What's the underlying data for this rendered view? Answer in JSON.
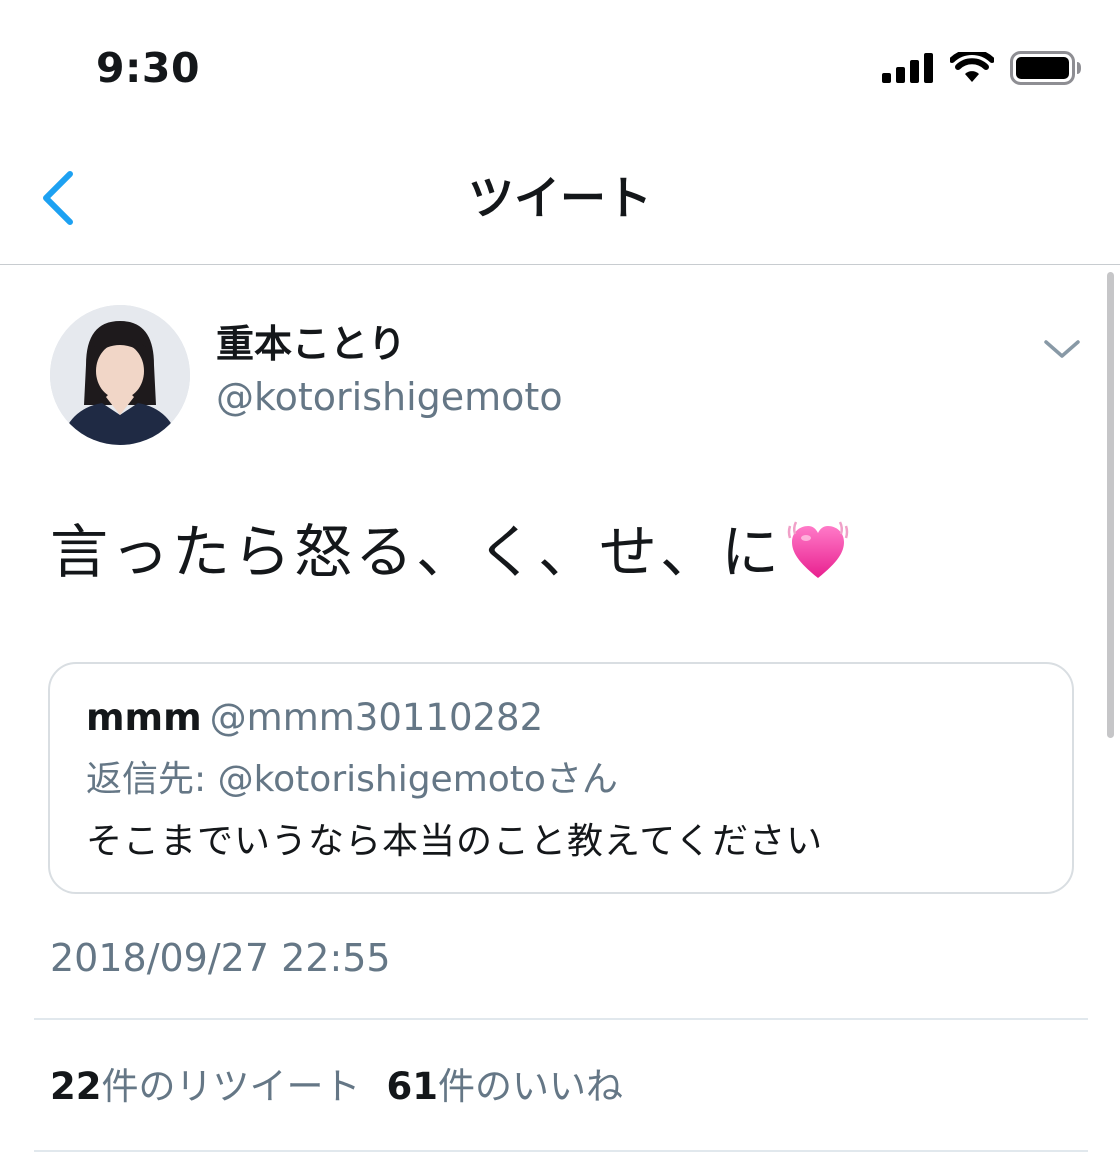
{
  "status_bar": {
    "time": "9:30",
    "signal_icon": "cellular-signal-icon",
    "wifi_icon": "wifi-icon",
    "battery_icon": "battery-icon",
    "battery_level": 1.0
  },
  "nav": {
    "back_icon": "chevron-left-icon",
    "title": "ツイート",
    "accent_color": "#1da1f2"
  },
  "tweet": {
    "author": {
      "display_name": "重本ことり",
      "handle": "@kotorishigemoto",
      "avatar": "profile-photo"
    },
    "text": "言ったら怒る、く、せ、に",
    "emoji": "growing-heart-emoji",
    "menu_icon": "chevron-down-icon",
    "quoted": {
      "name": "mmm",
      "handle": "@mmm30110282",
      "reply_prefix": "返信先:",
      "reply_to": "@kotorishigemotoさん",
      "text": "そこまでいうなら本当のこと教えてください"
    },
    "timestamp": "2018/09/27 22:55",
    "stats": {
      "retweets_count": "22",
      "retweets_label": "件のリツイート",
      "likes_count": "61",
      "likes_label": "件のいいね"
    }
  }
}
